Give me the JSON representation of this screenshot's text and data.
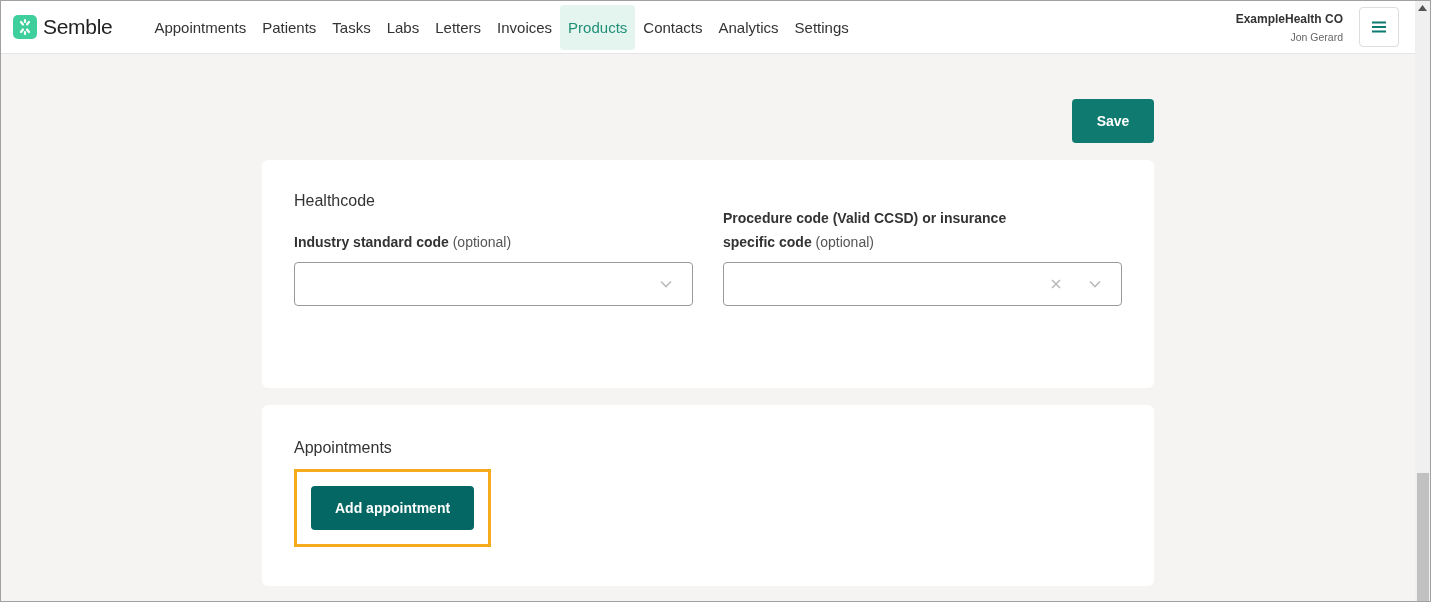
{
  "header": {
    "logo": "Semble",
    "nav": [
      {
        "label": "Appointments",
        "selected": false
      },
      {
        "label": "Patients",
        "selected": false
      },
      {
        "label": "Tasks",
        "selected": false
      },
      {
        "label": "Labs",
        "selected": false
      },
      {
        "label": "Letters",
        "selected": false
      },
      {
        "label": "Invoices",
        "selected": false
      },
      {
        "label": "Products",
        "selected": true
      },
      {
        "label": "Contacts",
        "selected": false
      },
      {
        "label": "Analytics",
        "selected": false
      },
      {
        "label": "Settings",
        "selected": false
      }
    ],
    "organization": "ExampleHealth CO",
    "user": "Jon Gerard"
  },
  "save_button": "Save",
  "healthcode": {
    "title": "Healthcode",
    "fields": [
      {
        "label": "**Industry standard code** (optional)",
        "clearable": false
      },
      {
        "label": "**Procedure code (Valid CCSD) or insurance specific code** (optional)",
        "clearable": true
      }
    ]
  },
  "appointments": {
    "title": "Appointments",
    "add_button": {
      "label": "Add appointment",
      "highlighted": true
    }
  }
}
